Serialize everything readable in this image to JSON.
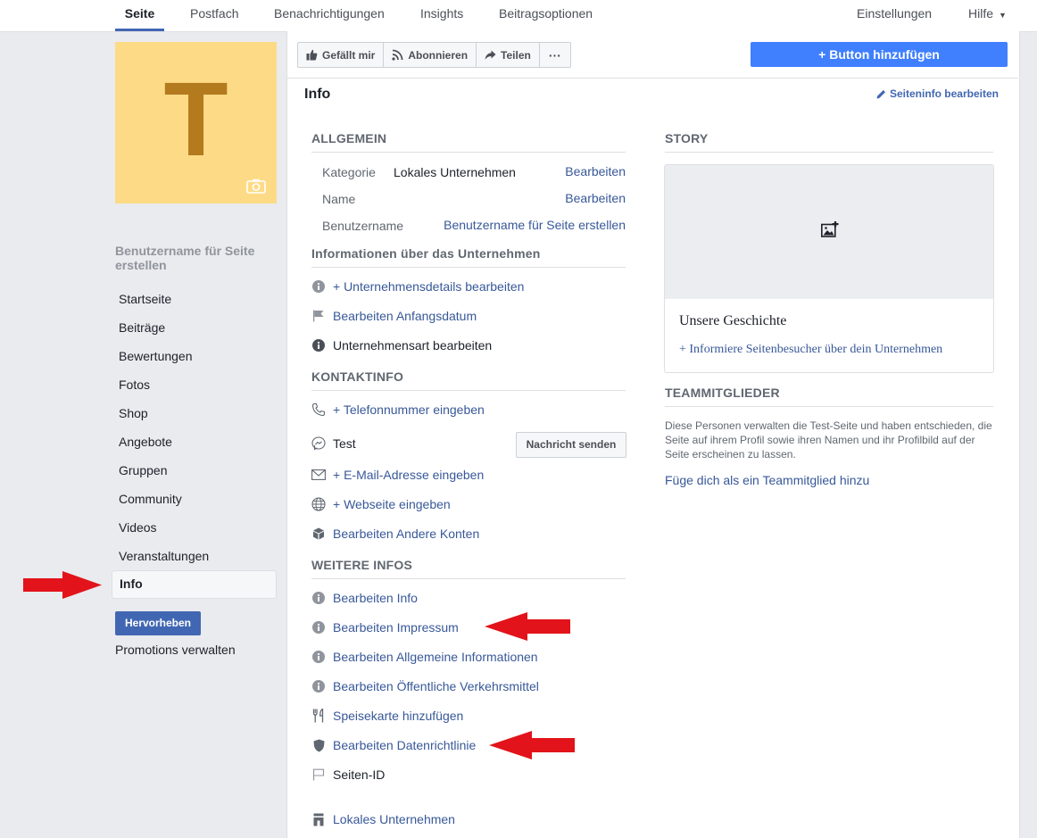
{
  "topnav": {
    "tabs": [
      "Seite",
      "Postfach",
      "Benachrichtigungen",
      "Insights",
      "Beitragsoptionen"
    ],
    "right": [
      "Einstellungen",
      "Hilfe"
    ]
  },
  "cover": {
    "letter": "T"
  },
  "leftnav": {
    "title": "Benutzername für Seite erstellen",
    "items": [
      "Startseite",
      "Beiträge",
      "Bewertungen",
      "Fotos",
      "Shop",
      "Angebote",
      "Gruppen",
      "Community",
      "Videos",
      "Veranstaltungen",
      "Info"
    ],
    "selected": "Info",
    "promote_button": "Hervorheben",
    "promotions": "Promotions verwalten"
  },
  "actionbar": {
    "like": "Gefällt mir",
    "subscribe": "Abonnieren",
    "share": "Teilen",
    "more": "···"
  },
  "add_button": "+ Button hinzufügen",
  "info": {
    "title": "Info",
    "edit": "Seiteninfo bearbeiten"
  },
  "allgemein": {
    "heading": "ALLGEMEIN",
    "kategorie_label": "Kategorie",
    "kategorie_value": "Lokales Unternehmen",
    "name_label": "Name",
    "benutzername_label": "Benutzername",
    "edit": "Bearbeiten",
    "create_username": "Benutzername für Seite erstellen"
  },
  "unternehmen": {
    "heading": "Informationen über das Unternehmen",
    "items": [
      "+ Unternehmensdetails bearbeiten",
      "Bearbeiten Anfangsdatum",
      "Unternehmensart bearbeiten"
    ]
  },
  "kontakt": {
    "heading": "KONTAKTINFO",
    "phone": "+ Telefonnummer eingeben",
    "messenger": "Test",
    "message_button": "Nachricht senden",
    "email": "+ E-Mail-Adresse eingeben",
    "website": "+ Webseite eingeben",
    "accounts": "Bearbeiten Andere Konten"
  },
  "weitere": {
    "heading": "WEITERE INFOS",
    "items": [
      "Bearbeiten Info",
      "Bearbeiten Impressum",
      "Bearbeiten Allgemeine Informationen",
      "Bearbeiten Öffentliche Verkehrsmittel",
      "Speisekarte hinzufügen",
      "Bearbeiten Datenrichtlinie",
      "Seiten-ID"
    ]
  },
  "footer_category": "Lokales Unternehmen",
  "story": {
    "heading": "STORY",
    "title": "Unsere Geschichte",
    "link": "+ Informiere Seitenbesucher über dein Unternehmen"
  },
  "team": {
    "heading": "TEAMMITGLIEDER",
    "description": "Diese Personen verwalten die Test-Seite und haben entschieden, die Seite auf ihrem Profil sowie ihren Namen und ihr Profilbild auf der Seite erscheinen zu lassen.",
    "link": "Füge dich als ein Teammitglied hinzu"
  },
  "colors": {
    "accent": "#4267b2",
    "add_button": "#4080ff",
    "cover": "#fddb86",
    "letter": "#b37a1e",
    "annotation_arrow": "#e2131a"
  },
  "icons": [
    "camera-icon",
    "thumbs-up-icon",
    "rss-icon",
    "share-icon",
    "pencil-icon",
    "info-icon",
    "flag-icon",
    "phone-icon",
    "messenger-icon",
    "envelope-icon",
    "globe-icon",
    "cube-icon",
    "fork-knife-icon",
    "shield-icon",
    "image-plus-icon",
    "shop-icon"
  ]
}
